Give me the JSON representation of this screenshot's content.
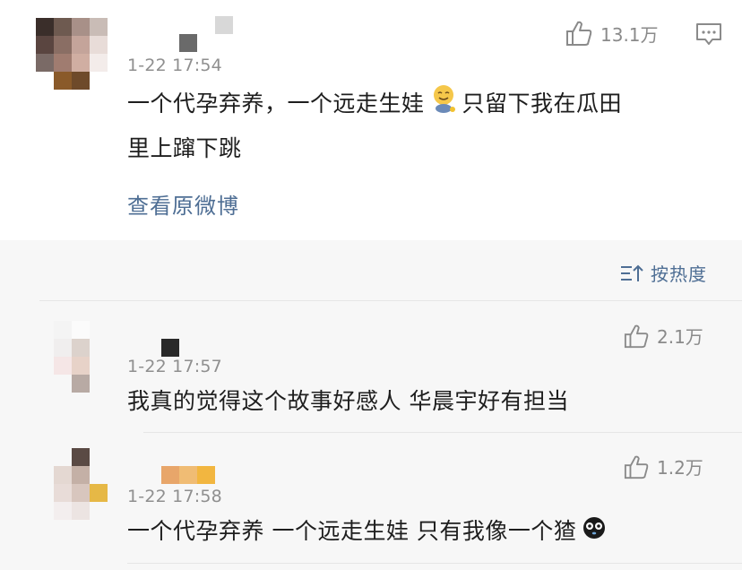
{
  "main_post": {
    "timestamp": "1-22 17:54",
    "likes": "13.1万",
    "text_line1_a": "一个代孕弃养，一个远走生娃",
    "text_line1_b": "只留下我在瓜田",
    "text_line2": "里上蹿下跳",
    "view_original": "查看原微博",
    "emoji_icon": "smiling-bear-emoji"
  },
  "comments_header": {
    "sort_label": "按热度",
    "sort_icon": "sort-icon"
  },
  "comments": [
    {
      "timestamp": "1-22 17:57",
      "likes": "2.1万",
      "text": "我真的觉得这个故事好感人 华晨宇好有担当"
    },
    {
      "timestamp": "1-22 17:58",
      "likes": "1.2万",
      "text": "一个代孕弃养 一个远走生娃 只有我像一个猹",
      "emoji_icon": "black-face-emoji"
    }
  ],
  "colors": {
    "link": "#4e6e94",
    "meta": "#8f8f8f",
    "comments_bg": "#f7f7f7"
  }
}
